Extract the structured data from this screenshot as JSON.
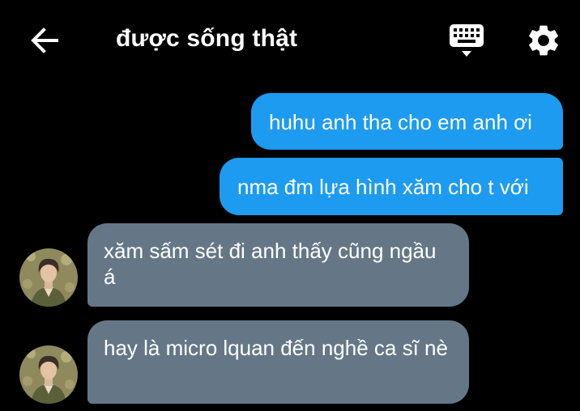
{
  "header": {
    "title": "được sống thật",
    "back_icon": "arrow-left-icon",
    "keyboard_icon": "keyboard-icon",
    "settings_icon": "gear-icon"
  },
  "messages": [
    {
      "direction": "outgoing",
      "text": "huhu anh tha cho em anh ơi"
    },
    {
      "direction": "outgoing",
      "text": "nma đm lựa hình xăm cho t với"
    },
    {
      "direction": "incoming",
      "text": "xăm sấm sét đi anh thấy cũng ngầu á"
    },
    {
      "direction": "incoming",
      "text": "hay là micro lquan đến nghề ca sĩ nè"
    }
  ],
  "colors": {
    "background": "#000000",
    "outgoing_bubble": "#1d9bf0",
    "incoming_bubble": "#657786",
    "text": "#ffffff"
  }
}
